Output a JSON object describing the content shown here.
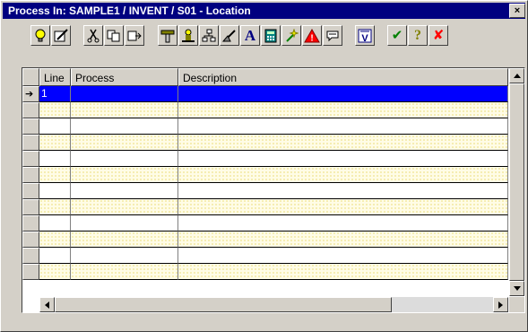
{
  "window": {
    "title": "Process In: SAMPLE1 / INVENT / S01 - Location",
    "close_glyph": "×"
  },
  "toolbar": {
    "buttons": [
      {
        "name": "hint-icon"
      },
      {
        "name": "edit-icon"
      },
      {
        "name": "cut-icon"
      },
      {
        "name": "copy-icon"
      },
      {
        "name": "paste-icon"
      },
      {
        "name": "tools-icon"
      },
      {
        "name": "user-icon"
      },
      {
        "name": "chart-icon"
      },
      {
        "name": "draw-icon"
      },
      {
        "name": "font-icon",
        "glyph": "A"
      },
      {
        "name": "calculator-icon"
      },
      {
        "name": "wand-icon"
      },
      {
        "name": "warning-icon",
        "glyph": "!"
      },
      {
        "name": "comment-icon"
      },
      {
        "name": "filter-icon",
        "glyph": "V"
      },
      {
        "name": "ok-icon",
        "glyph": "✔"
      },
      {
        "name": "help-icon",
        "glyph": "?"
      },
      {
        "name": "cancel-icon",
        "glyph": "✘"
      }
    ]
  },
  "grid": {
    "columns": [
      {
        "label": "Line"
      },
      {
        "label": "Process"
      },
      {
        "label": "Description"
      }
    ],
    "current_row_marker": "➔",
    "rows": [
      {
        "line": "1",
        "process": "",
        "description": "",
        "selected": true
      },
      {
        "line": "",
        "process": "",
        "description": ""
      },
      {
        "line": "",
        "process": "",
        "description": ""
      },
      {
        "line": "",
        "process": "",
        "description": ""
      },
      {
        "line": "",
        "process": "",
        "description": ""
      },
      {
        "line": "",
        "process": "",
        "description": ""
      },
      {
        "line": "",
        "process": "",
        "description": ""
      },
      {
        "line": "",
        "process": "",
        "description": ""
      },
      {
        "line": "",
        "process": "",
        "description": ""
      },
      {
        "line": "",
        "process": "",
        "description": ""
      },
      {
        "line": "",
        "process": "",
        "description": ""
      },
      {
        "line": "",
        "process": "",
        "description": ""
      }
    ]
  },
  "colors": {
    "title_bar": "#000080",
    "selected_row": "#0000ff",
    "row_fill": "#fffce6",
    "face": "#d4d0c8"
  }
}
